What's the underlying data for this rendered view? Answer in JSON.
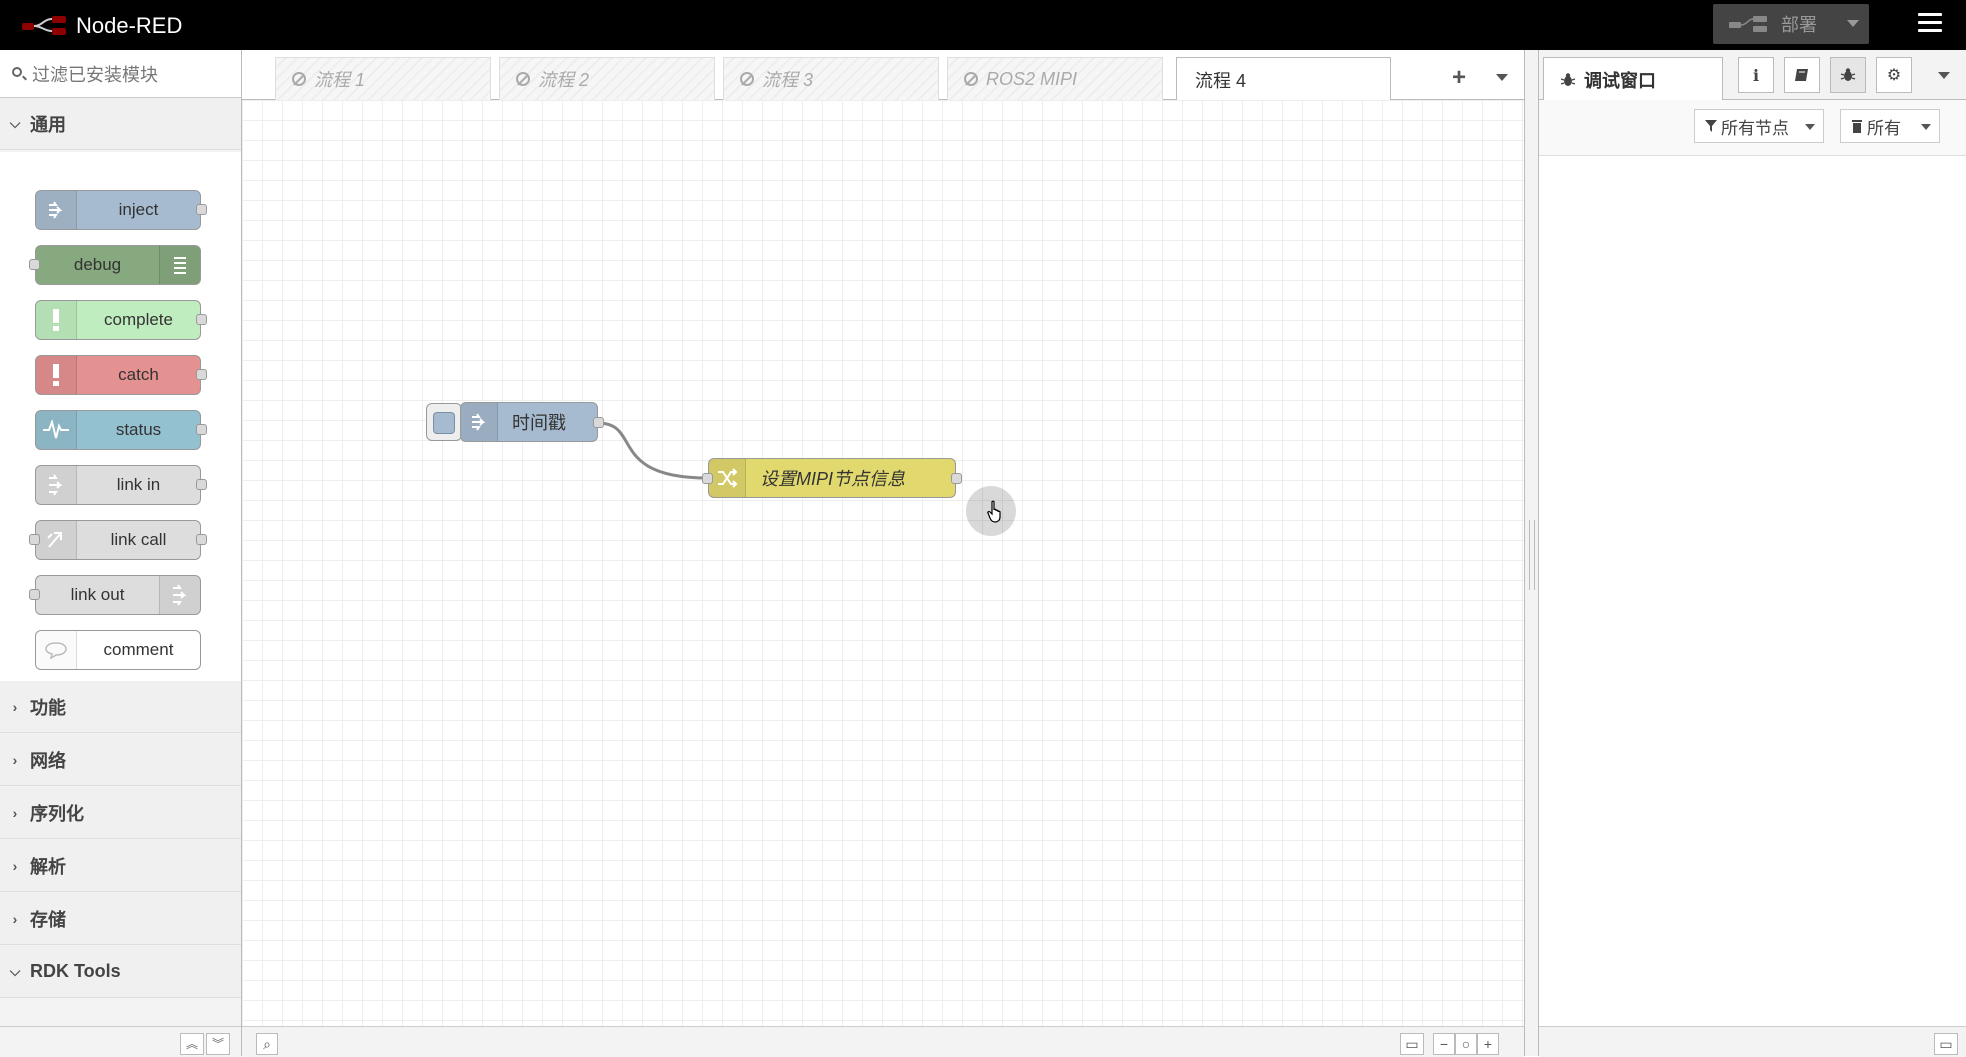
{
  "header": {
    "app_title": "Node-RED",
    "deploy_label": "部署"
  },
  "palette": {
    "search_placeholder": "过滤已安装模块",
    "categories": [
      {
        "label": "通用",
        "expanded": true
      },
      {
        "label": "功能",
        "expanded": false
      },
      {
        "label": "网络",
        "expanded": false
      },
      {
        "label": "序列化",
        "expanded": false
      },
      {
        "label": "解析",
        "expanded": false
      },
      {
        "label": "存储",
        "expanded": false
      },
      {
        "label": "RDK Tools",
        "expanded": true
      }
    ],
    "nodes": [
      {
        "label": "inject",
        "color": "#a6bbcf"
      },
      {
        "label": "debug",
        "color": "#87a980"
      },
      {
        "label": "complete",
        "color": "#c0edc0"
      },
      {
        "label": "catch",
        "color": "#e49191"
      },
      {
        "label": "status",
        "color": "#94c1d0"
      },
      {
        "label": "link in",
        "color": "#dddddd"
      },
      {
        "label": "link call",
        "color": "#dddddd"
      },
      {
        "label": "link out",
        "color": "#dddddd"
      },
      {
        "label": "comment",
        "color": "#ffffff"
      }
    ]
  },
  "workspace": {
    "tabs": [
      {
        "label": "流程 1",
        "disabled": true
      },
      {
        "label": "流程 2",
        "disabled": true
      },
      {
        "label": "流程 3",
        "disabled": true
      },
      {
        "label": "ROS2 MIPI",
        "disabled": true
      },
      {
        "label": "流程 4",
        "disabled": false,
        "active": true
      }
    ],
    "flow_nodes": [
      {
        "label": "时间戳",
        "type": "inject",
        "color": "#a6bbcf"
      },
      {
        "label": "设置MIPI节点信息",
        "type": "change",
        "color": "#e2d96e"
      }
    ]
  },
  "sidebar": {
    "active_tab_label": "调试窗口",
    "filter_nodes_label": "所有节点",
    "clear_label": "所有"
  }
}
